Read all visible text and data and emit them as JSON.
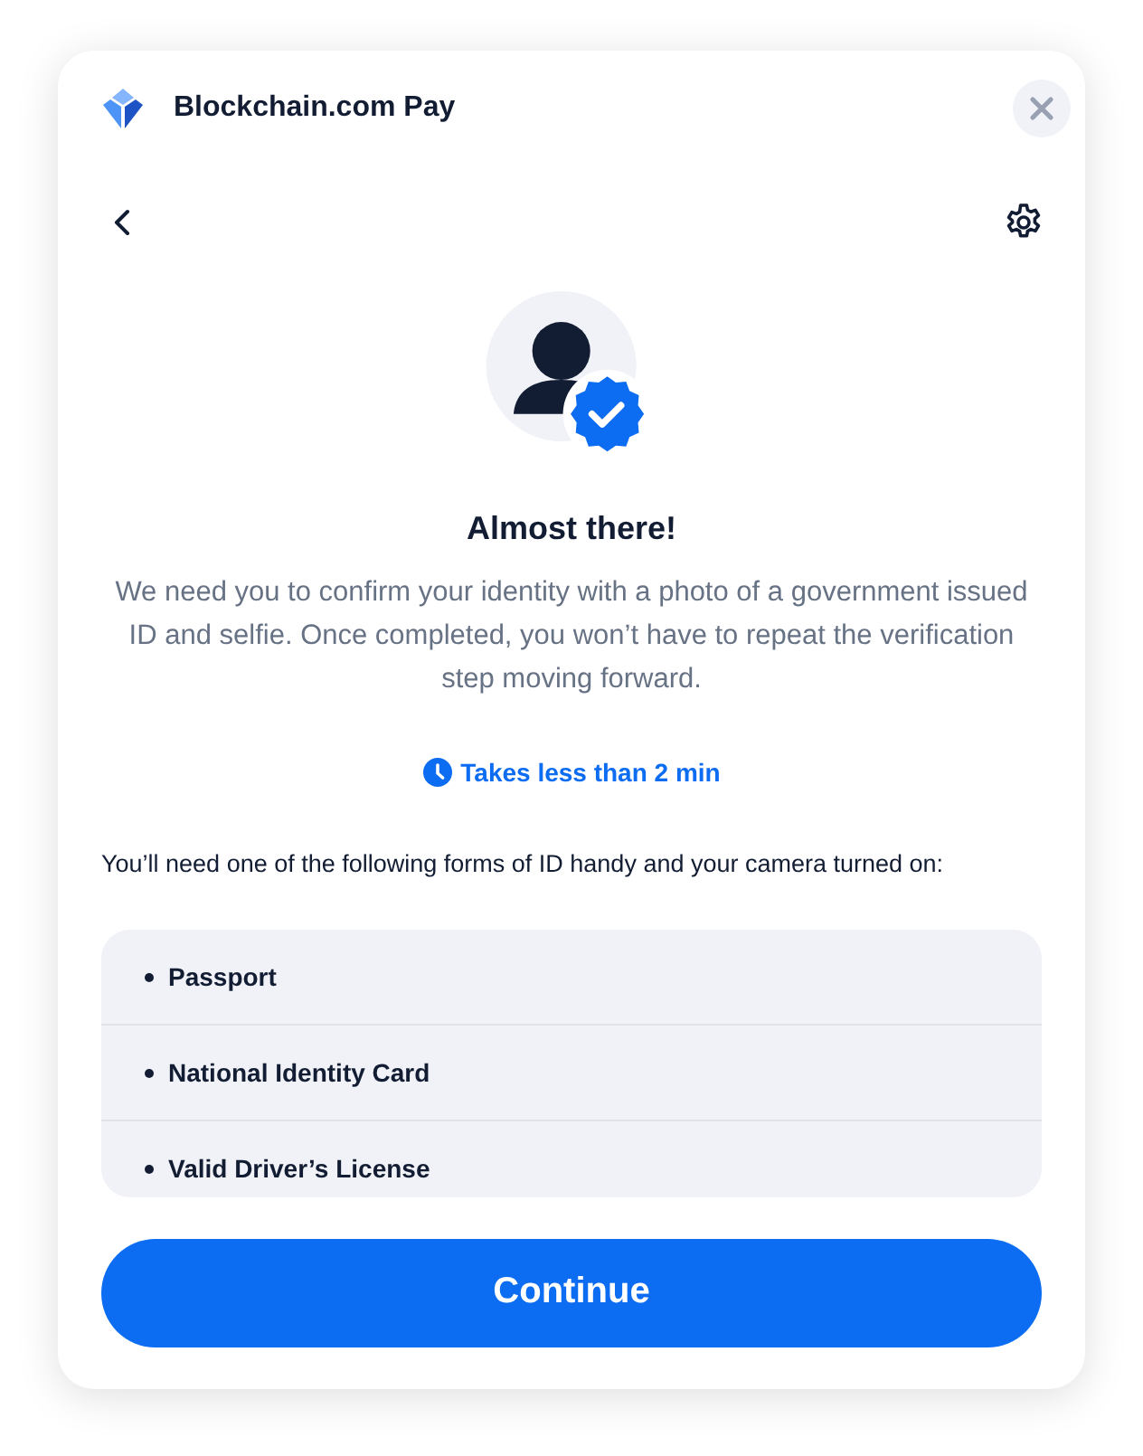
{
  "header": {
    "title": "Blockchain.com Pay"
  },
  "heading": "Almost there!",
  "description": "We need you to confirm your identity with a photo of a government issued ID and selfie. Once completed, you won’t have to repeat the verification step moving forward.",
  "duration": "Takes less than 2 min",
  "instruction": "You’ll need one of the following forms of ID handy and your camera turned on:",
  "id_forms": [
    {
      "label": "Passport"
    },
    {
      "label": "National Identity Card"
    },
    {
      "label": "Valid Driver’s License"
    }
  ],
  "primary_button": "Continue"
}
